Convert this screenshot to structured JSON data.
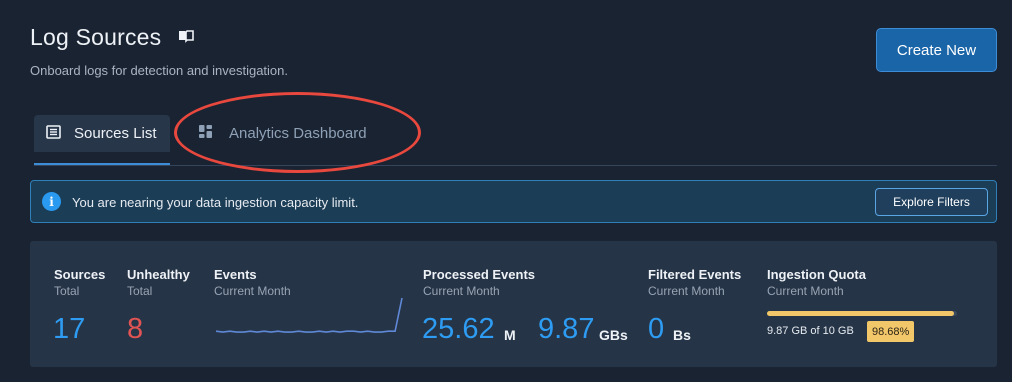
{
  "header": {
    "title": "Log Sources",
    "subtitle": "Onboard logs for detection and investigation.",
    "create_label": "Create New"
  },
  "tabs": [
    {
      "label": "Sources List",
      "icon": "list-icon",
      "active": true
    },
    {
      "label": "Analytics Dashboard",
      "icon": "grid-icon",
      "active": false
    }
  ],
  "alert": {
    "message": "You are nearing your data ingestion capacity limit.",
    "action_label": "Explore Filters"
  },
  "stats": {
    "sources": {
      "label": "Sources",
      "sub": "Total",
      "value": "17"
    },
    "unhealthy": {
      "label": "Unhealthy",
      "sub": "Total",
      "value": "8"
    },
    "events": {
      "label": "Events",
      "sub": "Current Month",
      "sparkline": [
        3,
        2,
        3,
        2,
        2,
        3,
        2,
        3,
        2,
        3,
        2,
        2,
        3,
        2,
        2,
        3,
        2,
        3,
        2,
        3,
        3,
        2,
        3,
        2,
        2,
        3,
        3,
        38
      ]
    },
    "processed": {
      "label": "Processed Events",
      "sub": "Current Month",
      "count": "25.62",
      "count_unit": "M",
      "size": "9.87",
      "size_unit": "GBs"
    },
    "filtered": {
      "label": "Filtered Events",
      "sub": "Current Month",
      "value": "0",
      "unit": "Bs"
    },
    "quota": {
      "label": "Ingestion Quota",
      "sub": "Current Month",
      "text": "9.87 GB of 10 GB",
      "percent_label": "98.68%",
      "fraction": 0.9868
    }
  },
  "colors": {
    "accent": "#2d9cf2",
    "danger": "#e05454",
    "warning": "#f2c76a",
    "highlight": "#e8483d"
  }
}
